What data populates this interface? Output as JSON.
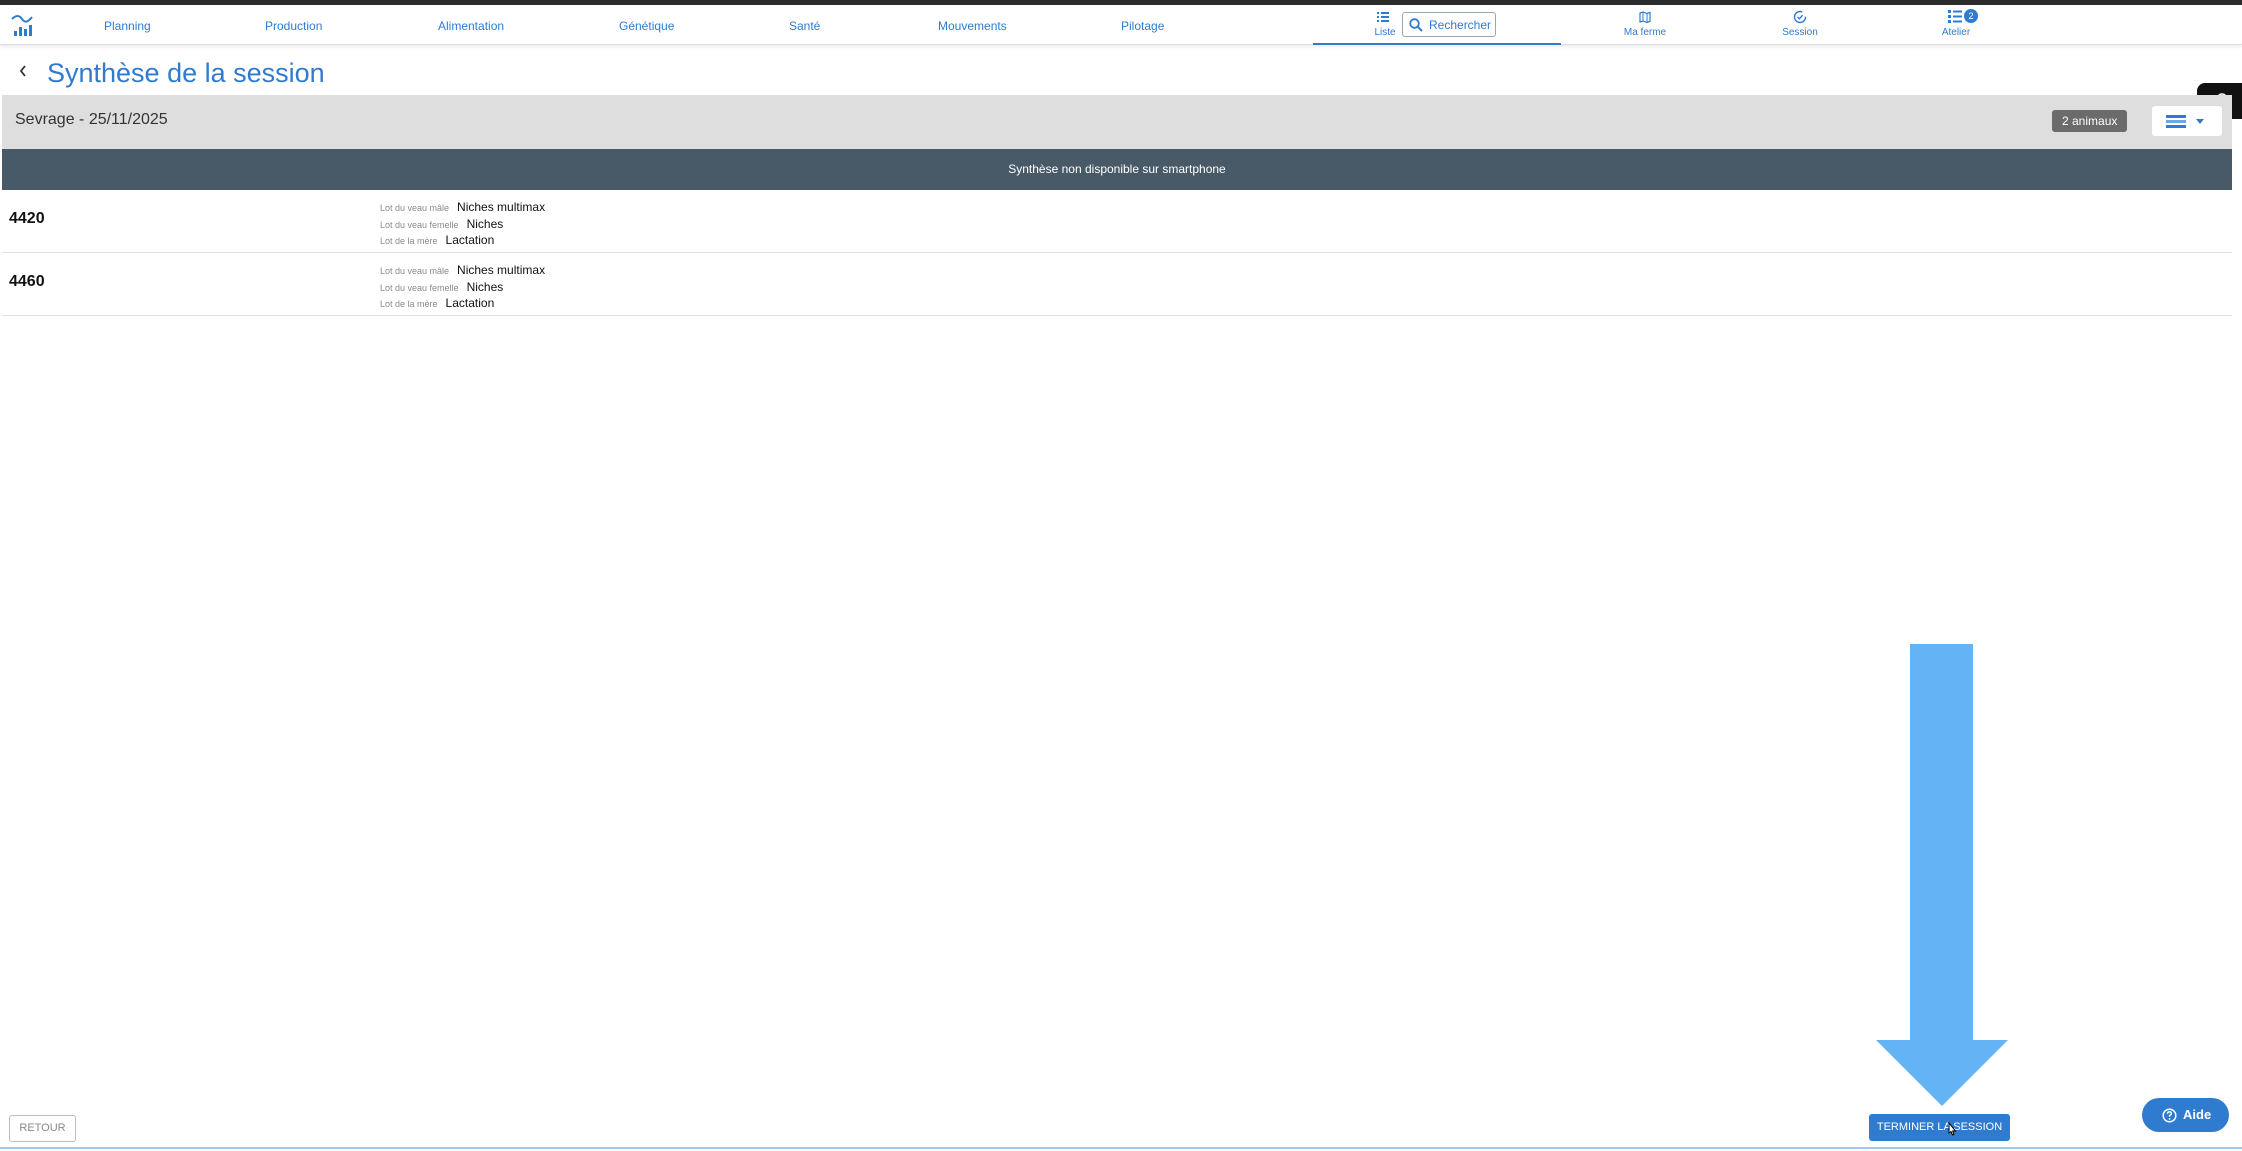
{
  "nav": {
    "items": [
      "Planning",
      "Production",
      "Alimentation",
      "Génétique",
      "Santé",
      "Mouvements",
      "Pilotage"
    ],
    "liste_label": "Liste",
    "search_placeholder": "Rechercher",
    "ma_ferme_label": "Ma ferme",
    "session_label": "Session",
    "atelier_label": "Atelier",
    "atelier_badge": "2",
    "accent_color": "#2f7bd0"
  },
  "page": {
    "title": "Synthèse de la session"
  },
  "session": {
    "name": "Sevrage - 25/11/2025",
    "count_badge": "2 animaux"
  },
  "notice": "Synthèse non disponible sur smartphone",
  "animals": [
    {
      "id": "4420",
      "lots": [
        {
          "label": "Lot du veau mâle",
          "value": "Niches multimax"
        },
        {
          "label": "Lot du veau femelle",
          "value": "Niches"
        },
        {
          "label": "Lot de la mère",
          "value": "Lactation"
        }
      ]
    },
    {
      "id": "4460",
      "lots": [
        {
          "label": "Lot du veau mâle",
          "value": "Niches multimax"
        },
        {
          "label": "Lot du veau femelle",
          "value": "Niches"
        },
        {
          "label": "Lot de la mère",
          "value": "Lactation"
        }
      ]
    }
  ],
  "footer": {
    "retour_label": "RETOUR",
    "terminer_label": "TERMINER LA SESSION",
    "aide_label": "Aide"
  }
}
